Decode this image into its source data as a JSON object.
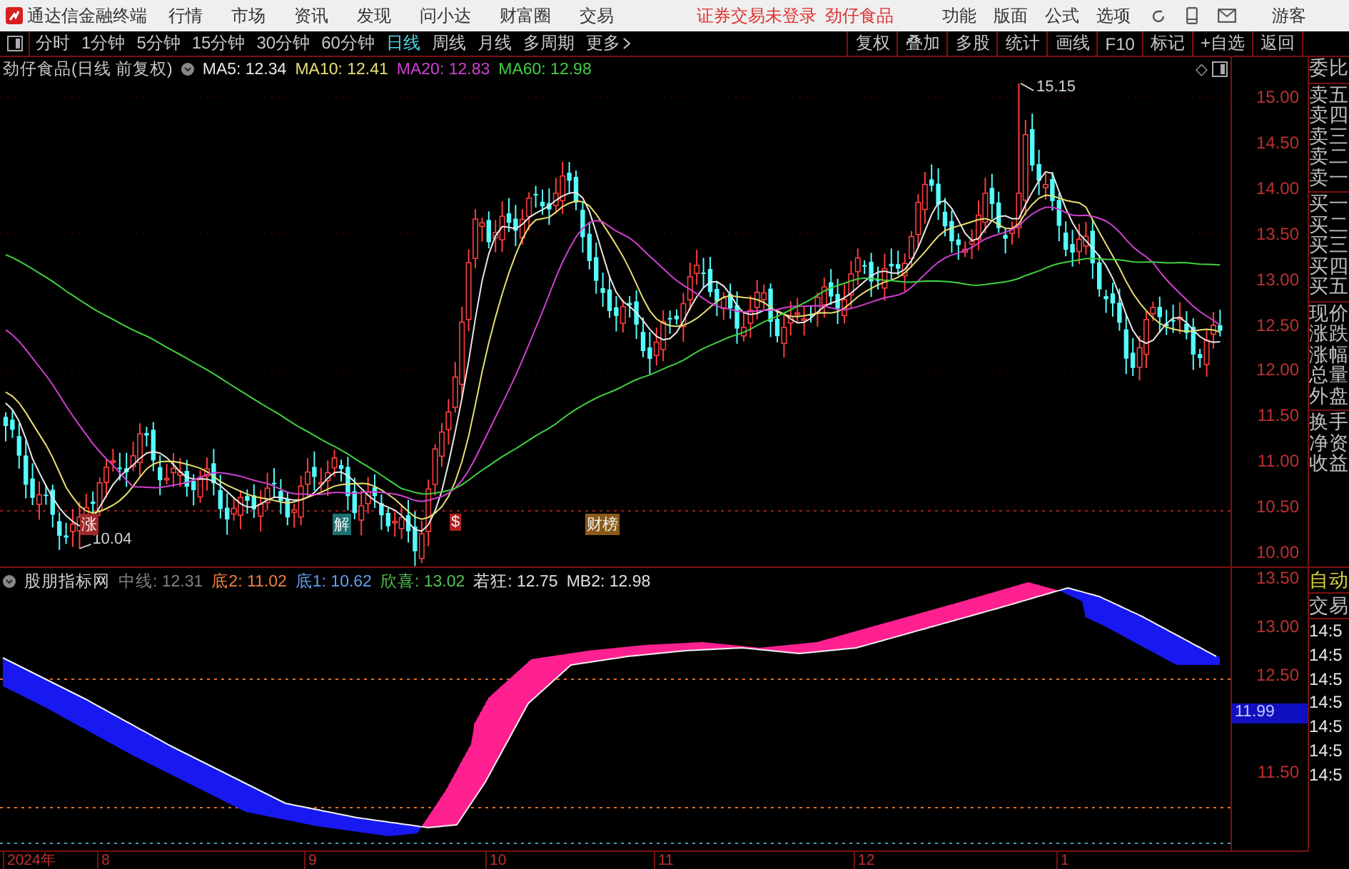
{
  "app": {
    "title": "通达信金融终端"
  },
  "menu": [
    "行情",
    "市场",
    "资讯",
    "发现",
    "问小达",
    "财富圈",
    "交易"
  ],
  "login_status": "证券交易未登录",
  "stock_name": "劲仔食品",
  "right_menu": [
    "功能",
    "版面",
    "公式",
    "选项"
  ],
  "user": "游客",
  "periods": [
    {
      "label": "分时",
      "selected": false
    },
    {
      "label": "1分钟",
      "selected": false
    },
    {
      "label": "5分钟",
      "selected": false
    },
    {
      "label": "15分钟",
      "selected": false
    },
    {
      "label": "30分钟",
      "selected": false
    },
    {
      "label": "60分钟",
      "selected": false
    },
    {
      "label": "日线",
      "selected": true
    },
    {
      "label": "周线",
      "selected": false
    },
    {
      "label": "月线",
      "selected": false
    },
    {
      "label": "多周期",
      "selected": false
    },
    {
      "label": "更多",
      "selected": false
    }
  ],
  "tools": [
    "复权",
    "叠加",
    "多股",
    "统计",
    "画线",
    "F10",
    "标记",
    "+自选",
    "返回"
  ],
  "main_chart": {
    "title": "劲仔食品(日线 前复权)",
    "diamond": "◇",
    "indicators": [
      {
        "label": "MA5: 12.34",
        "color": "#e8e8e8"
      },
      {
        "label": "MA10: 12.41",
        "color": "#e8e070"
      },
      {
        "label": "MA20: 12.83",
        "color": "#d040d0"
      },
      {
        "label": "MA60: 12.98",
        "color": "#40d040"
      }
    ],
    "price_ticks": [
      "15.00",
      "14.50",
      "14.00",
      "13.50",
      "13.00",
      "12.50",
      "12.00",
      "11.50",
      "11.00",
      "10.50",
      "10.00"
    ],
    "high_label": "15.15",
    "low_label": "10.04",
    "events": [
      {
        "label": "涨",
        "color": "#a02828"
      },
      {
        "label": "解",
        "color": "#1c7070"
      },
      {
        "label": "$",
        "color": "#b02020"
      },
      {
        "label": "财榜",
        "color": "#8a5a18"
      }
    ]
  },
  "indicator_pane": {
    "title": "股朋指标网",
    "values": [
      {
        "label": "中线: 12.31",
        "color": "#808080"
      },
      {
        "label": "底2: 11.02",
        "color": "#f08040"
      },
      {
        "label": "底1: 10.62",
        "color": "#60a0f0"
      },
      {
        "label": "欣喜: 13.02",
        "color": "#50c050"
      },
      {
        "label": "若狂: 12.75",
        "color": "#e0e0e0"
      },
      {
        "label": "MB2: 12.98",
        "color": "#e0e0e0"
      }
    ],
    "ticks": [
      "13.50",
      "13.00",
      "12.50",
      "11.50"
    ],
    "cursor_value": "11.99"
  },
  "time_axis": [
    "2024年",
    "8",
    "9",
    "10",
    "11",
    "12",
    "1"
  ],
  "quote_panel": {
    "groups": [
      [
        "委比"
      ],
      [
        "卖五",
        "卖四",
        "卖三",
        "卖二",
        "卖一"
      ],
      [
        "买一",
        "买二",
        "买三",
        "买四",
        "买五"
      ],
      [
        "现价",
        "涨跌",
        "涨幅",
        "总量",
        "外盘"
      ],
      [
        "换手",
        "净资",
        "收益"
      ]
    ],
    "mode": "自动",
    "trade_header": "交易",
    "times": [
      "14:5",
      "14:5",
      "14:5",
      "14:5",
      "14:5",
      "14:5",
      "14:5"
    ]
  }
}
